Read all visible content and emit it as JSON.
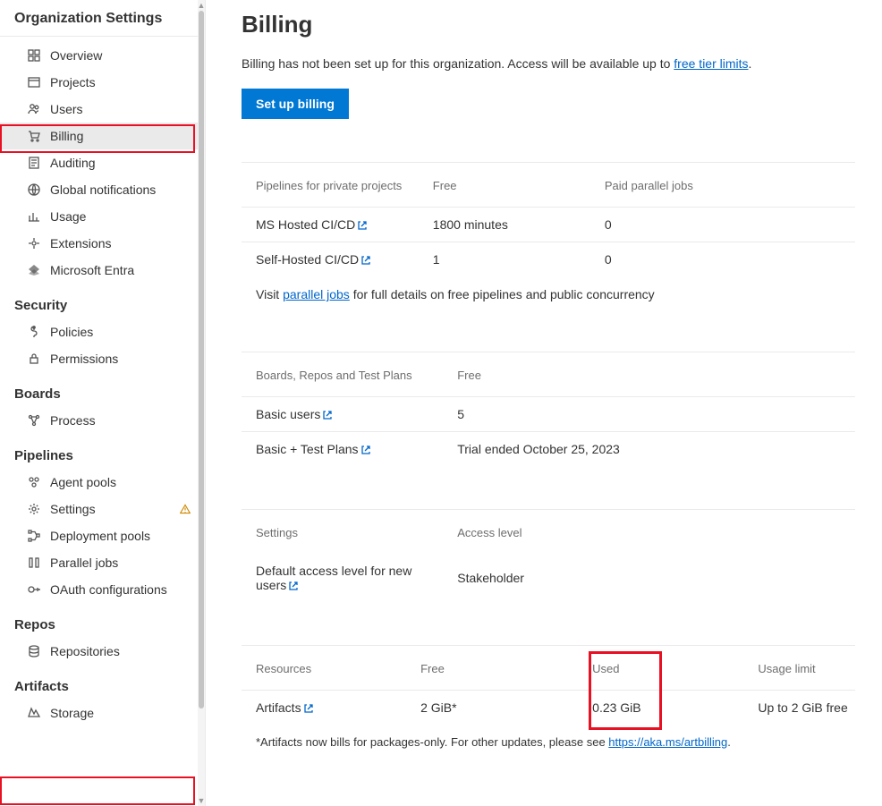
{
  "sidebar": {
    "header": "Organization Settings",
    "items": [
      {
        "label": "Overview"
      },
      {
        "label": "Projects"
      },
      {
        "label": "Users"
      },
      {
        "label": "Billing"
      },
      {
        "label": "Auditing"
      },
      {
        "label": "Global notifications"
      },
      {
        "label": "Usage"
      },
      {
        "label": "Extensions"
      },
      {
        "label": "Microsoft Entra"
      }
    ],
    "security": {
      "label": "Security",
      "items": [
        {
          "label": "Policies"
        },
        {
          "label": "Permissions"
        }
      ]
    },
    "boards": {
      "label": "Boards",
      "items": [
        {
          "label": "Process"
        }
      ]
    },
    "pipelines": {
      "label": "Pipelines",
      "items": [
        {
          "label": "Agent pools"
        },
        {
          "label": "Settings"
        },
        {
          "label": "Deployment pools"
        },
        {
          "label": "Parallel jobs"
        },
        {
          "label": "OAuth configurations"
        }
      ]
    },
    "repos": {
      "label": "Repos",
      "items": [
        {
          "label": "Repositories"
        }
      ]
    },
    "artifacts": {
      "label": "Artifacts",
      "items": [
        {
          "label": "Storage"
        }
      ]
    }
  },
  "page": {
    "title": "Billing",
    "intro_prefix": "Billing has not been set up for this organization. Access will be available up to ",
    "intro_link": "free tier limits",
    "intro_suffix": ".",
    "setup_btn": "Set up billing"
  },
  "pipelines_table": {
    "h1": "Pipelines for private projects",
    "h2": "Free",
    "h3": "Paid parallel jobs",
    "rows": [
      {
        "name": "MS Hosted CI/CD",
        "free": "1800 minutes",
        "paid": "0"
      },
      {
        "name": "Self-Hosted CI/CD",
        "free": "1",
        "paid": "0"
      }
    ],
    "note_prefix": "Visit ",
    "note_link": "parallel jobs",
    "note_suffix": " for full details on free pipelines and public concurrency"
  },
  "boards_table": {
    "h1": "Boards, Repos and Test Plans",
    "h2": "Free",
    "rows": [
      {
        "name": "Basic users",
        "free": "5"
      },
      {
        "name": "Basic + Test Plans",
        "free": "Trial ended October 25, 2023"
      }
    ]
  },
  "settings_table": {
    "h1": "Settings",
    "h2": "Access level",
    "row": {
      "name": "Default access level for new users",
      "val": "Stakeholder"
    }
  },
  "resources_table": {
    "h1": "Resources",
    "h2": "Free",
    "h3": "Used",
    "h4": "Usage limit",
    "row": {
      "name": "Artifacts",
      "free": "2 GiB*",
      "used": "0.23 GiB",
      "limit": "Up to 2 GiB free"
    },
    "footnote_prefix": "*Artifacts now bills for packages-only. For other updates, please see ",
    "footnote_link": "https://aka.ms/artbilling",
    "footnote_suffix": "."
  }
}
